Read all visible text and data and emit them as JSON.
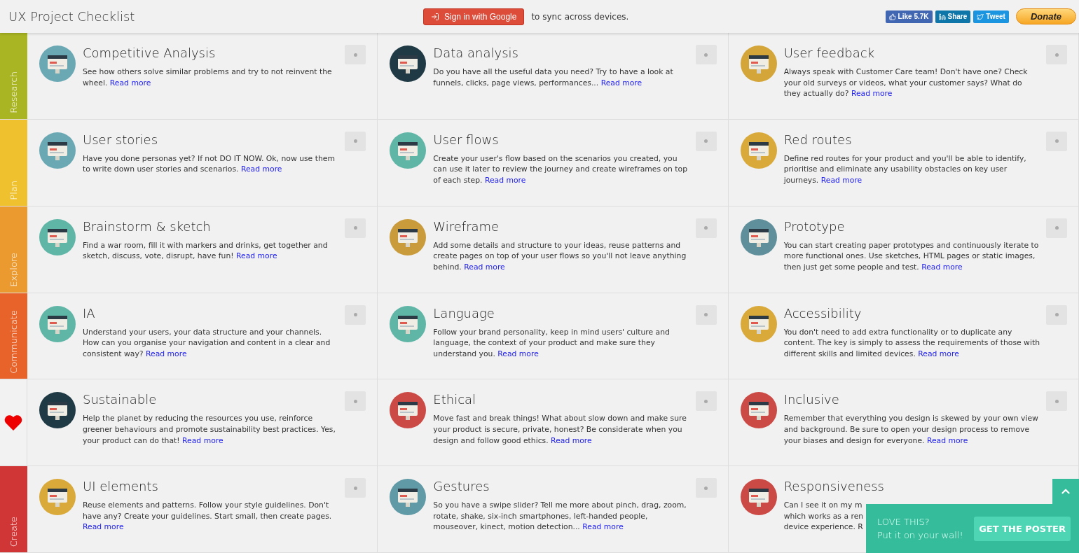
{
  "header": {
    "title": "UX Project Checklist",
    "signin": {
      "label": "Sign in with Google",
      "note": "to sync across devices."
    },
    "social": [
      {
        "kind": "facebook",
        "label": "Like 5.7K"
      },
      {
        "kind": "linkedin",
        "label": "Share"
      },
      {
        "kind": "twitter",
        "label": "Tweet"
      }
    ],
    "donate": "Donate"
  },
  "rows": [
    {
      "section": {
        "kind": "text",
        "label": "Research",
        "color": "#a9b523"
      },
      "cards": [
        {
          "title": "Competitive Analysis",
          "text": "See how others solve similar problems and try to not reinvent the wheel.",
          "link": "Read more",
          "checked": false
        },
        {
          "title": "Data analysis",
          "text": "Do you have all the useful data you need? Try to have a look at funnels, clicks, page views, performances...",
          "link": "Read more",
          "checked": false
        },
        {
          "title": "User feedback",
          "text": "Always speak with Customer Care team! Don't have one? Check your old surveys or videos, what your customer says? What do they actually do?",
          "link": "Read more",
          "checked": false
        }
      ]
    },
    {
      "section": {
        "kind": "text",
        "label": "Plan",
        "color": "#f0c12e"
      },
      "cards": [
        {
          "title": "User stories",
          "text": "Have you done personas yet? If not DO IT NOW. Ok, now use them to write down user stories and scenarios.",
          "link": "Read more",
          "checked": false
        },
        {
          "title": "User flows",
          "text": "Create your user's flow based on the scenarios you created, you can use it later to review the journey and create wireframes on top of each step.",
          "link": "Read more",
          "checked": false
        },
        {
          "title": "Red routes",
          "text": "Define red routes for your product and you'll be able to identify, prioritise and eliminate any usability obstacles on key user journeys.",
          "link": "Read more",
          "checked": false
        }
      ]
    },
    {
      "section": {
        "kind": "text",
        "label": "Explore",
        "color": "#ea9a2f"
      },
      "cards": [
        {
          "title": "Brainstorm & sketch",
          "text": "Find a war room, fill it with markers and drinks, get together and sketch, discuss, vote, disrupt, have fun!",
          "link": "Read more",
          "checked": false
        },
        {
          "title": "Wireframe",
          "text": "Add some details and structure to your ideas, reuse patterns and create pages on top of your user flows so you'll not leave anything behind.",
          "link": "Read more",
          "checked": false
        },
        {
          "title": "Prototype",
          "text": "You can start creating paper prototypes and continuously iterate to more functional ones. Use sketches, HTML pages or static images, then just get some people and test.",
          "link": "Read more",
          "checked": false
        }
      ]
    },
    {
      "section": {
        "kind": "text",
        "label": "Communicate",
        "color": "#e8632a"
      },
      "cards": [
        {
          "title": "IA",
          "text": "Understand your users, your data structure and your channels. How can you organise your navigation and content in a clear and consistent way?",
          "link": "Read more",
          "checked": false
        },
        {
          "title": "Language",
          "text": "Follow your brand personality, keep in mind users' culture and language, the context of your product and make sure they understand you.",
          "link": "Read more",
          "checked": false
        },
        {
          "title": "Accessibility",
          "text": "You don't need to add extra functionality or to duplicate any content. The key is simply to assess the requirements of those with different skills and limited devices.",
          "link": "Read more",
          "checked": false
        }
      ]
    },
    {
      "section": {
        "kind": "heart",
        "color": "#f2f2f2"
      },
      "cards": [
        {
          "title": "Sustainable",
          "text": "Help the planet by reducing the resources you use, reinforce greener behaviours and promote sustainability best practices. Yes, your product can do that!",
          "link": "Read more",
          "checked": false
        },
        {
          "title": "Ethical",
          "text": "Move fast and break things! What about slow down and make sure your product is secure, private, honest? Be considerate when you design and follow good ethics.",
          "link": "Read more",
          "checked": false
        },
        {
          "title": "Inclusive",
          "text": "Remember that everything you design is skewed by your own view and background. Be sure to open your design process to remove your biases and design for everyone.",
          "link": "Read more",
          "checked": false
        }
      ]
    },
    {
      "section": {
        "kind": "text",
        "label": "Create",
        "color": "#d13636"
      },
      "cards": [
        {
          "title": "UI elements",
          "text": "Reuse elements and patterns. Follow your style guidelines. Don't have any? Create your guidelines. Start small, then create pages.",
          "link": "Read more",
          "checked": false
        },
        {
          "title": "Gestures",
          "text": "So you have a swipe slider? Tell me more about pinch, drag, zoom, rotate, shake, six-inch smartphones, left-handed people, mouseover, kinect, motion detection...",
          "link": "Read more",
          "checked": false
        },
        {
          "title": "Responsiveness",
          "lines": [
            "Can I see it on my m",
            "which works as a ren",
            "device experience. R"
          ]
        }
      ]
    }
  ],
  "poster": {
    "heading": "LOVE THIS?",
    "subtext": "Put it on your wall!",
    "button": "GET THE POSTER"
  }
}
